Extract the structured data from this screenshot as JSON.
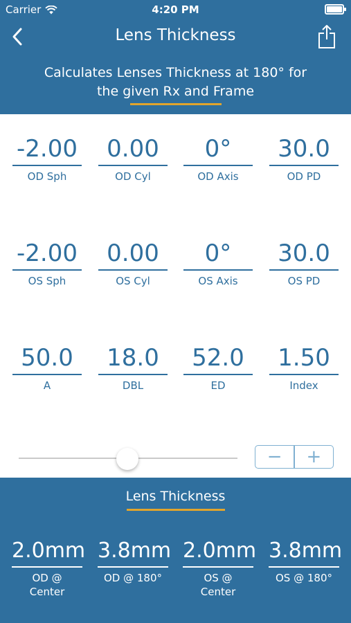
{
  "status": {
    "carrier": "Carrier",
    "time": "4:20 PM"
  },
  "nav": {
    "title": "Lens Thickness"
  },
  "subtitle": {
    "line1": "Calculates Lenses Thickness at 180° for",
    "line2": "the given Rx and Frame"
  },
  "od": [
    {
      "value": "-2.00",
      "label": "OD Sph"
    },
    {
      "value": "0.00",
      "label": "OD Cyl"
    },
    {
      "value": "0°",
      "label": "OD Axis"
    },
    {
      "value": "30.0",
      "label": "OD PD"
    }
  ],
  "os": [
    {
      "value": "-2.00",
      "label": "OS Sph"
    },
    {
      "value": "0.00",
      "label": "OS Cyl"
    },
    {
      "value": "0°",
      "label": "OS Axis"
    },
    {
      "value": "30.0",
      "label": "OS PD"
    }
  ],
  "frame": [
    {
      "value": "50.0",
      "label": "A"
    },
    {
      "value": "18.0",
      "label": "DBL"
    },
    {
      "value": "52.0",
      "label": "ED"
    },
    {
      "value": "1.50",
      "label": "Index"
    }
  ],
  "stepper": {
    "minus": "−",
    "plus": "+"
  },
  "results": {
    "title": "Lens Thickness",
    "items": [
      {
        "value": "2.0mm",
        "label1": "OD @",
        "label2": "Center"
      },
      {
        "value": "3.8mm",
        "label1": "OD @ 180°",
        "label2": ""
      },
      {
        "value": "2.0mm",
        "label1": "OS @",
        "label2": "Center"
      },
      {
        "value": "3.8mm",
        "label1": "OS @ 180°",
        "label2": ""
      }
    ]
  },
  "colors": {
    "primary": "#2f6f9e",
    "accent": "#e2a52c",
    "stepper": "#7fb0d1"
  }
}
